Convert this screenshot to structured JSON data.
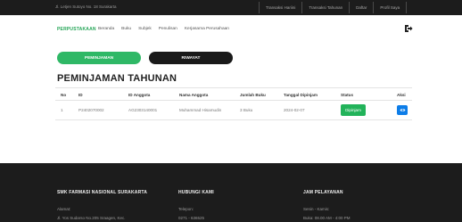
{
  "topbar": {
    "address": "Jl. Letjen Sutoyo No. 18 Surakarta",
    "links": [
      "Transaksi Hariini",
      "Transaksi Tahunan",
      "Daftar",
      "Profil Saya"
    ]
  },
  "nav": {
    "brand": "PERPUSTAKAAN",
    "menu": [
      "Beranda",
      "Buku",
      "Subjek",
      "Penulisan",
      "Kerjasama Perusahaan"
    ]
  },
  "tabs": {
    "peminjaman": "PEMINJAMAN",
    "riwayat": "RIWAYAT"
  },
  "page_title": "PEMINJAMAN TAHUNAN",
  "table": {
    "headers": [
      "No",
      "ID",
      "ID Anggota",
      "Nama Anggota",
      "Jumlah Buku",
      "Tanggal Dipinjam",
      "Status",
      "Aksi"
    ],
    "rows": [
      {
        "no": "1",
        "id": "P2402070002",
        "id_anggota": "AG2303140001",
        "nama": "Muhammad Hisamudin",
        "jumlah": "3 Buku",
        "tanggal": "2024-02-07",
        "status": "Dipinjam"
      }
    ]
  },
  "footer": {
    "col1": {
      "heading": "SMK FARMASI NASIONAL SURAKARTA",
      "line1": "Alamat:",
      "line2": "Jl. Yos Sudarso No.205 Sraagen, Kec."
    },
    "col2": {
      "heading": "HUBUNGI KAMI",
      "line1": "Telepon:",
      "line2": "0271 - 636525"
    },
    "col3": {
      "heading": "JAM PELAYANAN",
      "line1": "Senin - Kamis:",
      "line2": "Buka: 08.00 AM - 4:00 PM"
    }
  },
  "colors": {
    "accent_green": "#2fb866",
    "dark": "#1c1c1c",
    "button_blue": "#0d7de8"
  },
  "icons": {
    "logout": "logout-icon",
    "view": "eye-icon"
  }
}
